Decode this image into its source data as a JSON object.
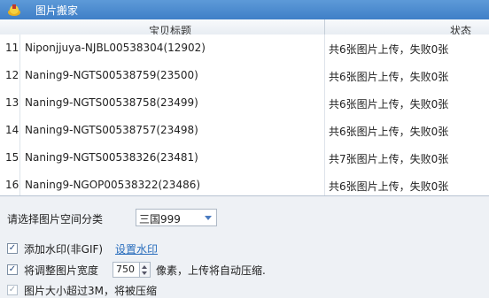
{
  "window": {
    "title": "图片搬家"
  },
  "table": {
    "columns": [
      "宝贝标题",
      "状态"
    ],
    "rows": [
      {
        "num": "11",
        "title": "Niponjjuya-NJBL00538304(12902)",
        "status": "共6张图片上传，失败0张"
      },
      {
        "num": "12",
        "title": "Naning9-NGTS00538759(23500)",
        "status": "共6张图片上传，失败0张"
      },
      {
        "num": "13",
        "title": "Naning9-NGTS00538758(23499)",
        "status": "共6张图片上传，失败0张"
      },
      {
        "num": "14",
        "title": "Naning9-NGTS00538757(23498)",
        "status": "共6张图片上传，失败0张"
      },
      {
        "num": "15",
        "title": "Naning9-NGTS00538326(23481)",
        "status": "共7张图片上传，失败0张"
      },
      {
        "num": "16",
        "title": "Naning9-NGOP00538322(23486)",
        "status": "共6张图片上传，失败0张"
      }
    ]
  },
  "options": {
    "category_label": "请选择图片空间分类",
    "category_value": "三国999",
    "watermark_label": "添加水印(非GIF)",
    "watermark_link": "设置水印",
    "resize_label": "将调整图片宽度",
    "resize_value": "750",
    "resize_suffix": "像素，上传将自动压缩.",
    "oversize_label": "图片大小超过3M，将被压缩"
  },
  "icons": {
    "app": "app-logo-icon",
    "dropdown": "chevron-down-icon"
  },
  "colors": {
    "titlebar": "#4a89cf",
    "link": "#2a6ebd"
  }
}
